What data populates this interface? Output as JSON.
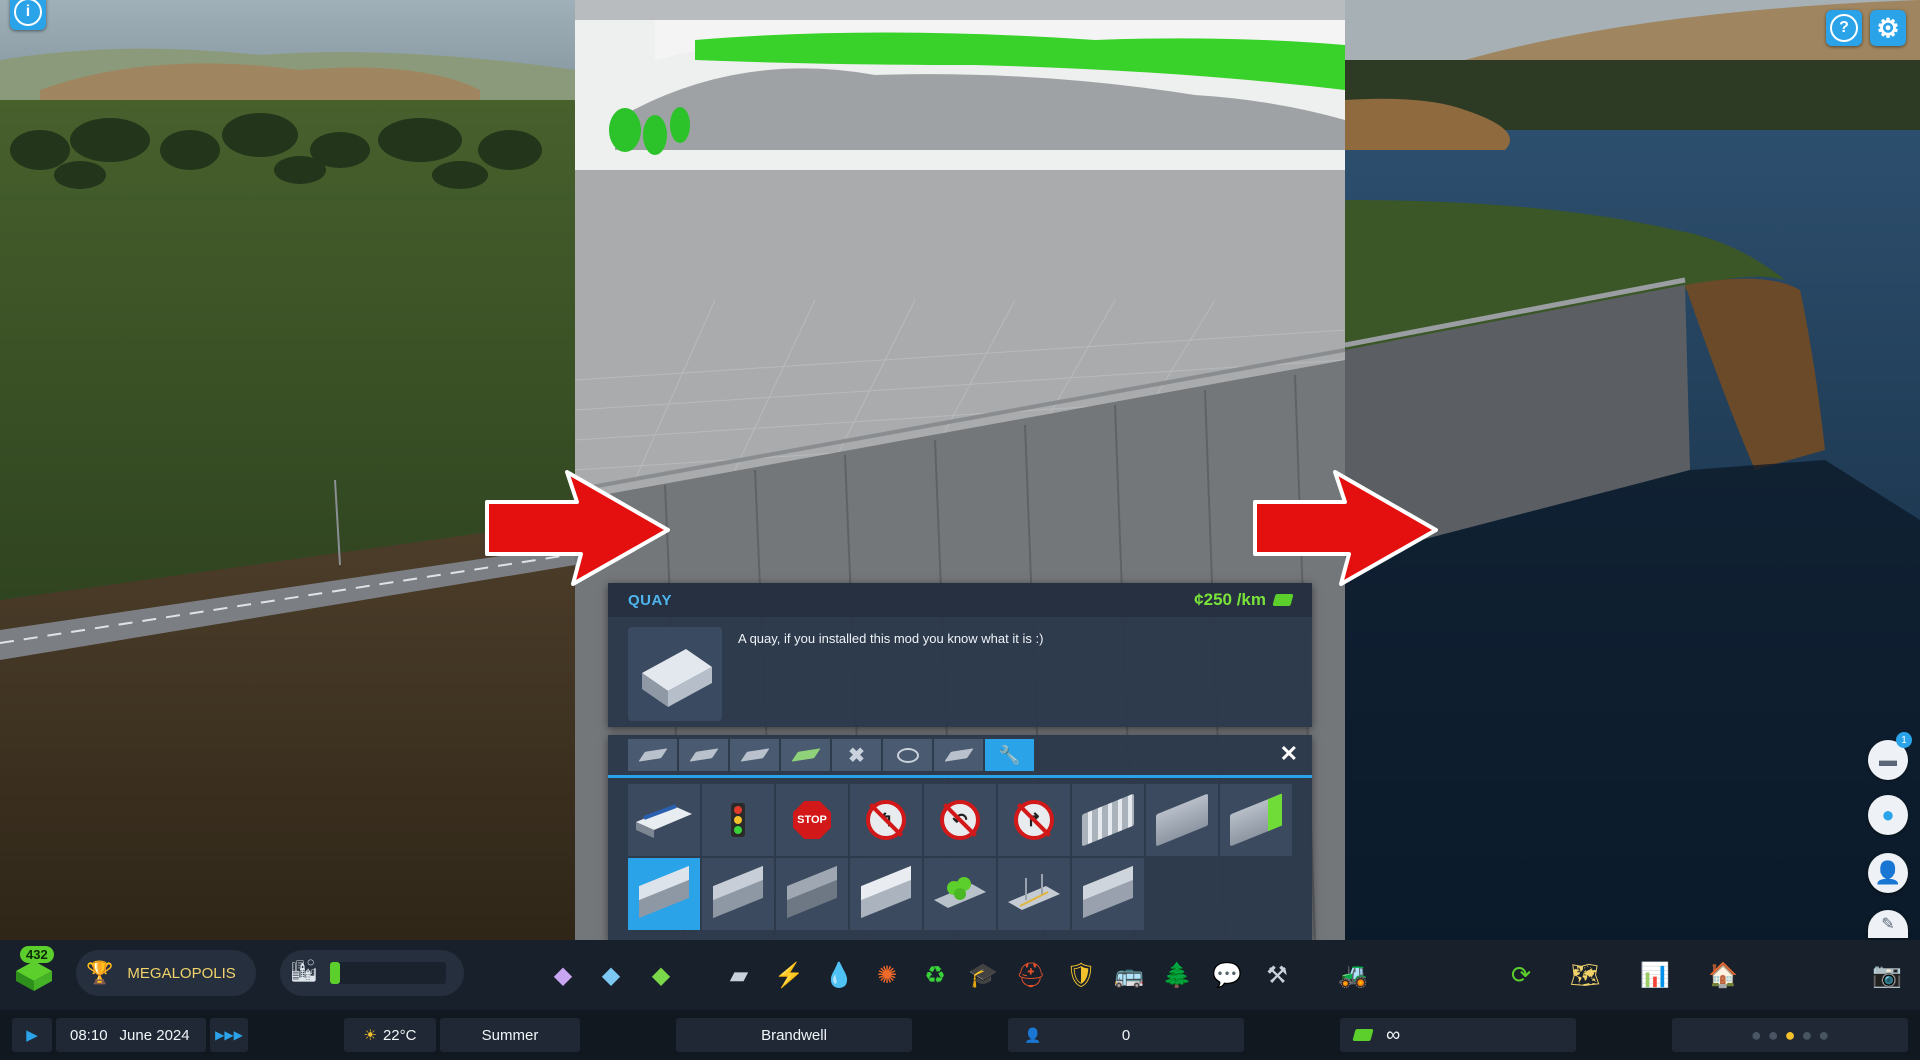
{
  "info_panel": {
    "title": "QUAY",
    "cost": "¢250 /km",
    "description": "A quay, if you installed this mod you know what it is :)"
  },
  "toolbar": {
    "xp": "432",
    "milestone": "MEGALOPOLIS"
  },
  "bottom_bar": {
    "time": "08:10",
    "date": "June 2024",
    "temperature": "22°C",
    "season": "Summer",
    "city_name": "Brandwell",
    "population": "0",
    "money": "∞"
  },
  "notifications": {
    "count": "1"
  },
  "colors": {
    "accent": "#2aa3e8",
    "money": "#79e23a",
    "arrow": "#e41010"
  },
  "icons": {
    "top_left": "info-icon",
    "top_right": [
      "help-icon",
      "settings-icon"
    ]
  }
}
